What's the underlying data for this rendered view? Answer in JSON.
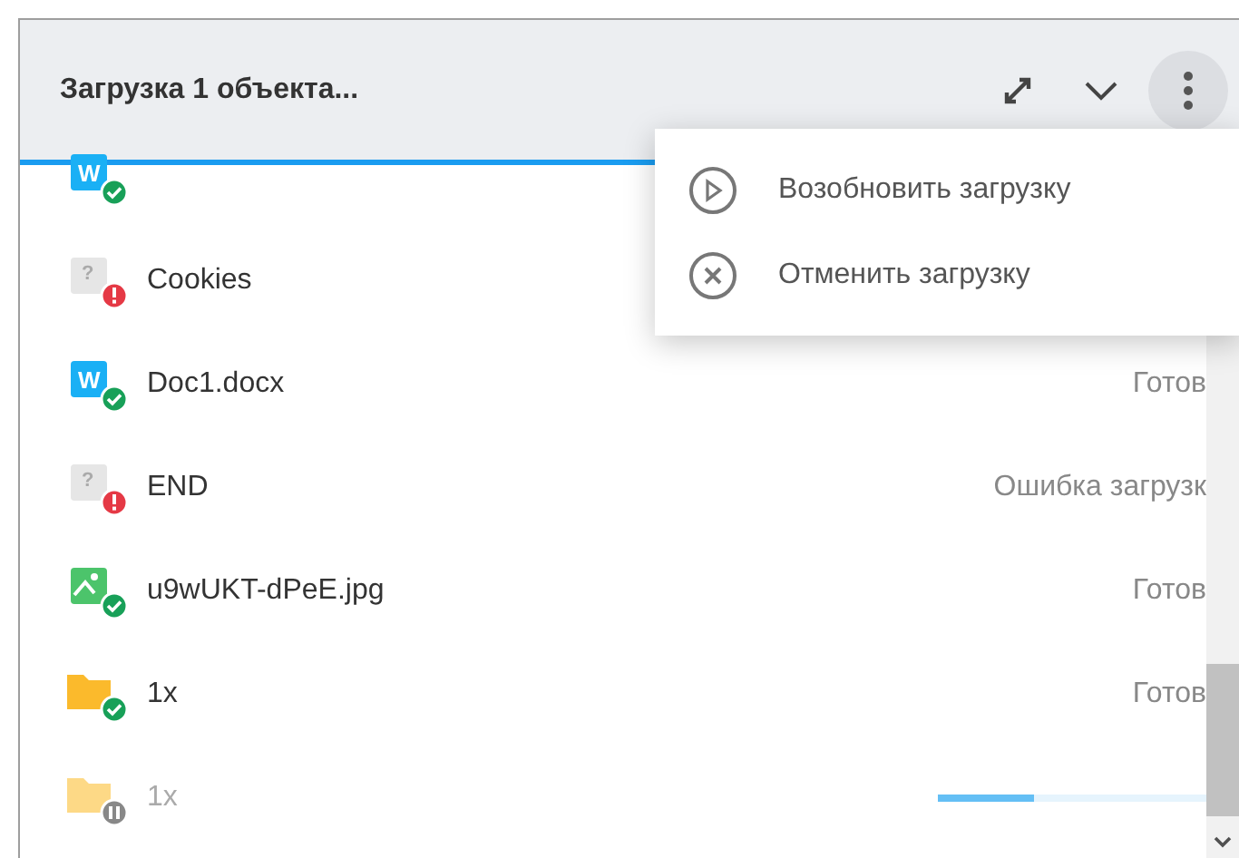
{
  "panel": {
    "title": "Загрузка 1 объекта..."
  },
  "rows": [
    {
      "kind": "word",
      "icon_text": "W",
      "uploaded": true,
      "failed": false,
      "paused": false
    },
    {
      "kind": "unknown",
      "icon_text": "?",
      "name": "Cookies",
      "uploaded": false,
      "failed": true,
      "paused": false
    },
    {
      "kind": "word",
      "icon_text": "W",
      "name": "Doc1.docx",
      "uploaded": true,
      "failed": false,
      "paused": false,
      "status_text": "Готов"
    },
    {
      "kind": "unknown",
      "icon_text": "?",
      "name": "END",
      "uploaded": false,
      "failed": true,
      "paused": false,
      "status_text": "Ошибка загрузк"
    },
    {
      "kind": "image",
      "name": "u9wUKT-dPeE.jpg",
      "uploaded": true,
      "failed": false,
      "paused": false,
      "status_text": "Готов"
    },
    {
      "kind": "folder",
      "name": "1x",
      "uploaded": true,
      "failed": false,
      "paused": false,
      "status_text": "Готов"
    },
    {
      "kind": "folder",
      "name": "1x",
      "uploaded": false,
      "failed": false,
      "paused": true,
      "level": 0.36
    }
  ],
  "menu": {
    "items": [
      {
        "kind": "resume",
        "label": "Возобновить загрузку"
      },
      {
        "kind": "cancel",
        "label": "Отменить загрузку"
      }
    ]
  }
}
